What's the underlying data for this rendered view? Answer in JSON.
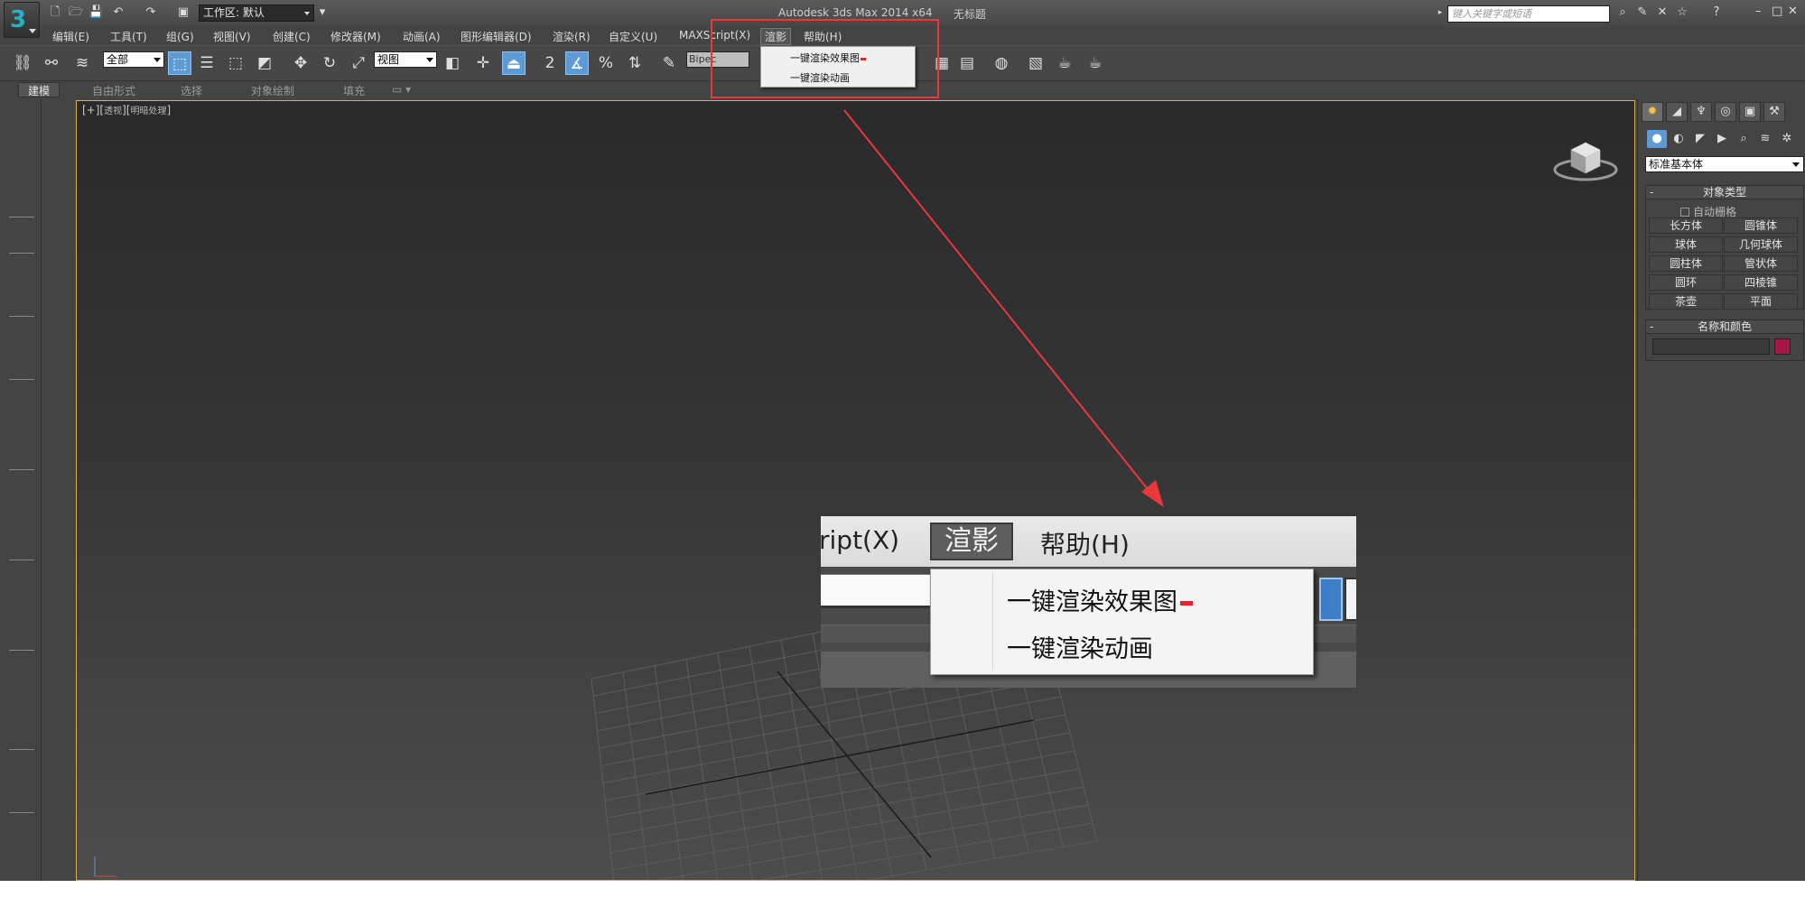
{
  "titlebar": {
    "workspace_label": "工作区: 默认",
    "app_title": "Autodesk 3ds Max  2014 x64",
    "doc_title": "无标题",
    "search_placeholder": "键入关键字或短语"
  },
  "menubar": {
    "items": [
      "编辑(E)",
      "工具(T)",
      "组(G)",
      "视图(V)",
      "创建(C)",
      "修改器(M)",
      "动画(A)",
      "图形编辑器(D)",
      "渲染(R)",
      "自定义(U)",
      "MAXScript(X)",
      "渲影",
      "帮助(H)"
    ]
  },
  "toolbar": {
    "selection_filter": "全部",
    "reference_coord": "视图",
    "named_selection": "Bipec",
    "snap_number": "2"
  },
  "ribbon": {
    "tabs": [
      "建模",
      "自由形式",
      "选择",
      "对象绘制",
      "填充"
    ]
  },
  "viewport": {
    "label_main": "[+][",
    "label_view": "透视",
    "label_mid": "][",
    "label_shading": "明暗处理",
    "label_end": "]"
  },
  "dropdown_menu": {
    "items": [
      "一键渲染效果图",
      "一键渲染动画"
    ]
  },
  "callout": {
    "script_fragment": "ript(X)",
    "active_menu": "渲影",
    "help_menu": "帮助(H)",
    "items": [
      "一键渲染效果图",
      "一键渲染动画"
    ]
  },
  "command_panel": {
    "category": "标准基本体",
    "object_type_title": "对象类型",
    "autogrid_label": "自动栅格",
    "object_buttons": [
      "长方体",
      "圆锥体",
      "球体",
      "几何球体",
      "圆柱体",
      "管状体",
      "圆环",
      "四棱锥",
      "茶壶",
      "平面"
    ],
    "name_color_title": "名称和颜色",
    "object_color": "#a51846"
  },
  "colors": {
    "highlight": "#e8383b",
    "accent_blue": "#5e9bd6",
    "viewport_border": "#d3b44c"
  }
}
